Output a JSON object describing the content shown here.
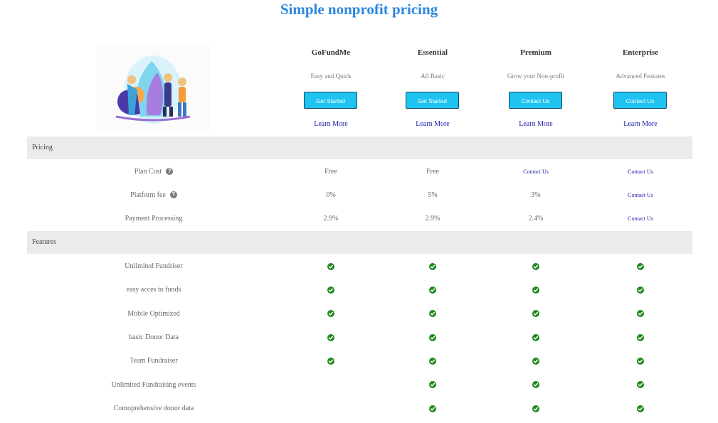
{
  "title": "Simple nonprofit pricing",
  "plans": [
    {
      "name": "GoFundMe",
      "subtitle": "Easy and Quick",
      "button": "Get Started",
      "link": "Learn More"
    },
    {
      "name": "Essential",
      "subtitle": "All Basic",
      "button": "Get Started",
      "link": "Learn More"
    },
    {
      "name": "Premium",
      "subtitle": "Grow your Non-profit",
      "button": "Contact Us",
      "link": "Learn More"
    },
    {
      "name": "Enterprise",
      "subtitle": "Advanced Features",
      "button": "Contact Us",
      "link": "Learn More"
    }
  ],
  "sections": {
    "pricing": "Pricing",
    "features": "Features"
  },
  "pricing_rows": [
    {
      "label": "Plan Cost",
      "help": true,
      "values": [
        "Free",
        "Free",
        "Contact Us",
        "Contact Us"
      ],
      "links": [
        false,
        false,
        true,
        true
      ]
    },
    {
      "label": "Platform fee",
      "help": true,
      "values": [
        "0%",
        "5%",
        "3%",
        "Contact Us"
      ],
      "links": [
        false,
        false,
        false,
        true
      ]
    },
    {
      "label": "Payment Processing",
      "help": false,
      "values": [
        "2.9%",
        "2.9%",
        "2.4%",
        "Contact Us"
      ],
      "links": [
        false,
        false,
        false,
        true
      ]
    }
  ],
  "feature_rows": [
    {
      "label": "Unlimited Fundriser",
      "checks": [
        true,
        true,
        true,
        true
      ]
    },
    {
      "label": "easy acces to funds",
      "checks": [
        true,
        true,
        true,
        true
      ]
    },
    {
      "label": "Mobile Optimized",
      "checks": [
        true,
        true,
        true,
        true
      ]
    },
    {
      "label": "basic Donor Data",
      "checks": [
        true,
        true,
        true,
        true
      ]
    },
    {
      "label": "Team Fundraiser",
      "checks": [
        true,
        true,
        true,
        true
      ]
    },
    {
      "label": "Unlimited Fundraising events",
      "checks": [
        false,
        true,
        true,
        true
      ]
    },
    {
      "label": "Comoprehensive donor data",
      "checks": [
        false,
        true,
        true,
        true
      ]
    }
  ],
  "colors": {
    "title": "#2f86e0",
    "button": "#1ec3f1",
    "link": "#1a1aa6",
    "check": "#1f8a1f"
  },
  "icons": {
    "help": "question-circle-icon",
    "check": "check-circle-icon",
    "illustration": "gardening-team-illustration"
  }
}
